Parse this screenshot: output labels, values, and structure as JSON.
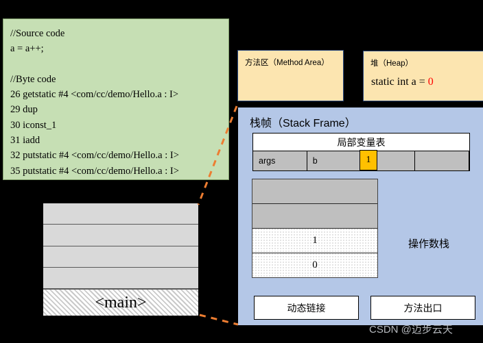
{
  "source_panel": {
    "lines": [
      "//Source code",
      "a = a++;",
      "",
      "//Byte code",
      "26 getstatic #4 <com/cc/demo/Hello.a : I>",
      "29 dup",
      "30 iconst_1",
      "31 iadd",
      "32 putstatic #4 <com/cc/demo/Hello.a : I>",
      "35 putstatic #4 <com/cc/demo/Hello.a : I>"
    ]
  },
  "method_area": {
    "title": "方法区（Method Area）"
  },
  "heap": {
    "title": "堆（Heap）",
    "static_decl_prefix": "static int a = ",
    "static_value": "0",
    "value_color": "#ff0000"
  },
  "call_stack": {
    "slots": [
      "",
      "",
      "",
      ""
    ],
    "bottom_frame_label": "<main>"
  },
  "stack_frame": {
    "title": "栈帧（Stack Frame）",
    "local_variable_table": {
      "header": "局部变量表",
      "cells": [
        "args",
        "b",
        "",
        ""
      ],
      "badge_value": "1",
      "badge_color": "#ffc000"
    },
    "operand_stack": {
      "label": "操作数栈",
      "slots": [
        {
          "value": "",
          "style": "empty"
        },
        {
          "value": "",
          "style": "empty"
        },
        {
          "value": "1",
          "style": "dotted"
        },
        {
          "value": "0",
          "style": "dotted"
        }
      ]
    },
    "buttons": {
      "dynamic_link": "动态链接",
      "method_exit": "方法出口"
    },
    "panel_color": "#b4c7e7"
  },
  "watermark": {
    "text": "CSDN @迈步云天"
  },
  "connector": {
    "color": "#ed7d31"
  }
}
